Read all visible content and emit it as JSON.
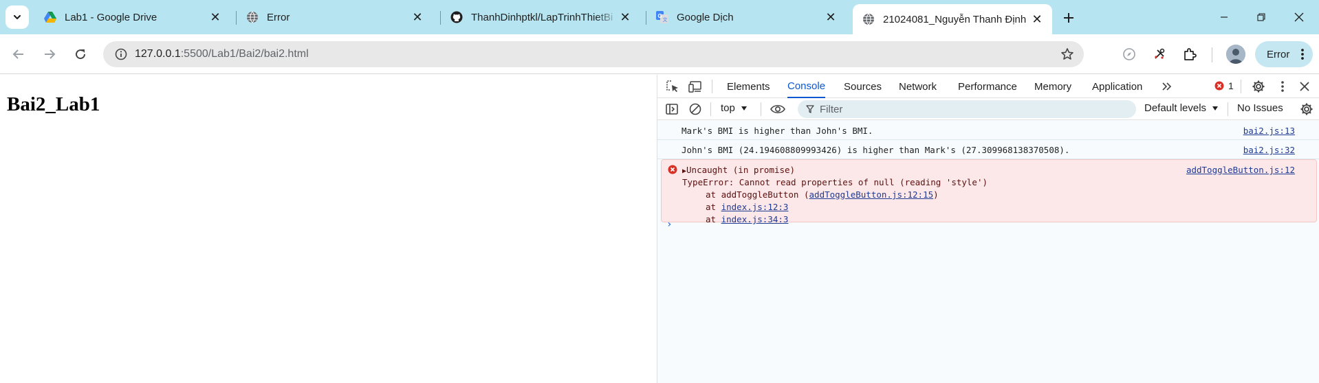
{
  "tabs": [
    {
      "title": "Lab1 - Google Drive",
      "icon": "google-drive-icon"
    },
    {
      "title": "Error",
      "icon": "globe-icon"
    },
    {
      "title": "ThanhDinhptkl/LapTrinhThietBi",
      "icon": "github-icon"
    },
    {
      "title": "Google Dịch",
      "icon": "google-translate-icon"
    },
    {
      "title": "21024081_Nguyễn Thanh Định",
      "icon": "globe-icon"
    }
  ],
  "address": {
    "host": "127.0.0.1",
    "path": ":5500/Lab1/Bai2/bai2.html"
  },
  "profile": {
    "error_label": "Error"
  },
  "page": {
    "heading": "Bai2_Lab1"
  },
  "devtools": {
    "tabs": [
      "Elements",
      "Console",
      "Sources",
      "Network",
      "Performance",
      "Memory",
      "Application"
    ],
    "active_tab": "Console",
    "error_count": "1",
    "context": "top",
    "filter_placeholder": "Filter",
    "levels": "Default levels",
    "issues": "No Issues",
    "messages": [
      {
        "text": "Mark's BMI is higher than John's BMI.",
        "source": "bai2.js:13"
      },
      {
        "text": "John's BMI (24.194608809993426) is higher than Mark's (27.309968138370508).",
        "source": "bai2.js:32"
      }
    ],
    "error": {
      "summary": "Uncaught (in promise)",
      "source": "addToggleButton.js:12",
      "message": "TypeError: Cannot read properties of null (reading 'style')",
      "frame1_prefix": "at addToggleButton (",
      "frame1_link": "addToggleButton.js:12:15",
      "frame1_suffix": ")",
      "frame_at": "at",
      "frame2_link": "index.js:12:3",
      "frame3_link": "index.js:34:3"
    }
  },
  "colors": {
    "tabstrip": "#b6e4f0",
    "accent": "#0b57d0",
    "error_bg": "#fce8e8"
  }
}
